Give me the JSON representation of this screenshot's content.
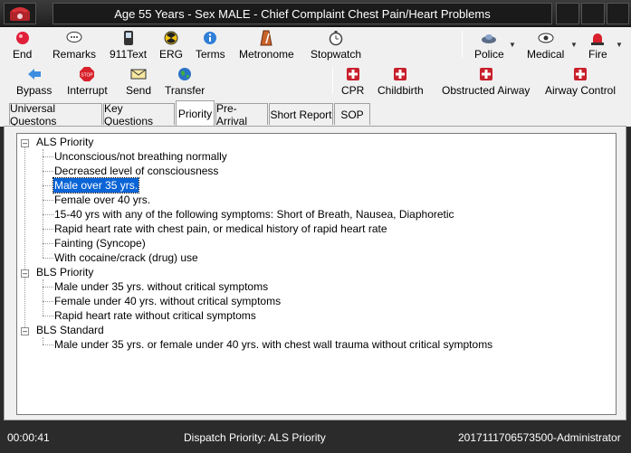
{
  "window": {
    "title": "Age 55 Years - Sex MALE - Chief Complaint Chest Pain/Heart Problems"
  },
  "toolbar1": {
    "end": "End",
    "remarks": "Remarks",
    "text911": "911Text",
    "erg": "ERG",
    "terms": "Terms",
    "metronome": "Metronome",
    "stopwatch": "Stopwatch",
    "police": "Police",
    "medical": "Medical",
    "fire": "Fire"
  },
  "toolbar2": {
    "bypass": "Bypass",
    "interrupt": "Interrupt",
    "send": "Send",
    "transfer": "Transfer",
    "cpr": "CPR",
    "childbirth": "Childbirth",
    "obstructed_airway": "Obstructed Airway",
    "airway_control": "Airway Control"
  },
  "tabs": [
    "Universal Questons",
    "Key Questions",
    "Priority",
    "Pre-Arrival",
    "Short Report",
    "SOP"
  ],
  "active_tab": "Priority",
  "tree": {
    "groups": [
      {
        "label": "ALS Priority",
        "items": [
          "Unconscious/not breathing normally",
          "Decreased level of consciousness",
          "Male over 35 yrs.",
          "Female over 40 yrs.",
          "15-40 yrs with any of the following symptoms: Short of Breath, Nausea, Diaphoretic",
          "Rapid heart rate with chest pain, or medical history of rapid heart rate",
          "Fainting (Syncope)",
          "With cocaine/crack (drug) use"
        ]
      },
      {
        "label": "BLS Priority",
        "items": [
          "Male under 35 yrs. without critical symptoms",
          "Female under 40 yrs. without critical symptoms",
          "Rapid heart rate without critical symptoms"
        ]
      },
      {
        "label": "BLS Standard",
        "items": [
          "Male under 35 yrs. or female under 40 yrs. with chest wall trauma without critical symptoms"
        ]
      }
    ],
    "selected_item": "Male over 35 yrs."
  },
  "status": {
    "timer": "00:00:41",
    "dispatch_priority": "Dispatch Priority: ALS Priority",
    "record_user": "2017111706573500-Administrator"
  },
  "colors": {
    "selection": "#0a64d6",
    "chrome_dark": "#2b2b2b",
    "toolbar_bg": "#f0f0f0"
  }
}
